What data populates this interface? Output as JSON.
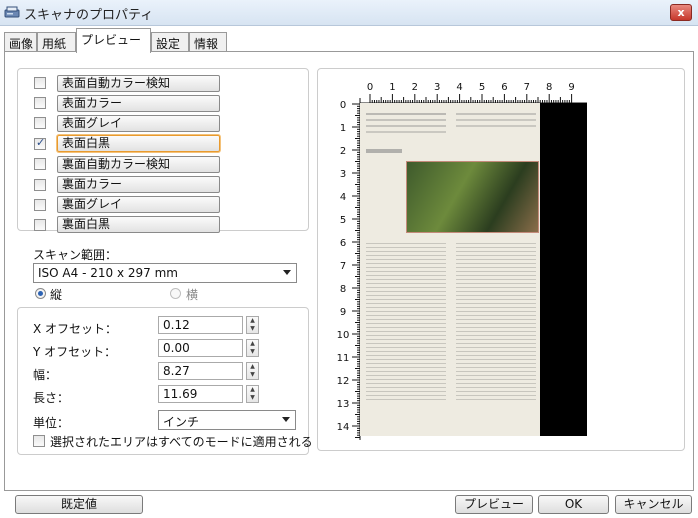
{
  "window": {
    "title": "スキャナのプロパティ",
    "close_label": "x"
  },
  "tabs": [
    {
      "label": "画像",
      "active": false
    },
    {
      "label": "用紙",
      "active": false
    },
    {
      "label": "プレビュー",
      "active": true
    },
    {
      "label": "設定",
      "active": false
    },
    {
      "label": "情報",
      "active": false
    }
  ],
  "modes": [
    {
      "label": "表面自動カラー検知",
      "checked": false,
      "selected": false
    },
    {
      "label": "表面カラー",
      "checked": false,
      "selected": false
    },
    {
      "label": "表面グレイ",
      "checked": false,
      "selected": false
    },
    {
      "label": "表面白黒",
      "checked": true,
      "selected": true
    },
    {
      "label": "裏面自動カラー検知",
      "checked": false,
      "selected": false
    },
    {
      "label": "裏面カラー",
      "checked": false,
      "selected": false
    },
    {
      "label": "裏面グレイ",
      "checked": false,
      "selected": false
    },
    {
      "label": "裏面白黒",
      "checked": false,
      "selected": false
    }
  ],
  "scan_area": {
    "label": "スキャン範囲：",
    "value": "ISO A4 - 210 x 297 mm",
    "portrait_label": "縦",
    "landscape_label": "横",
    "orientation": "portrait"
  },
  "fields": {
    "x_offset": {
      "label": "X オフセット：",
      "value": "0.12"
    },
    "y_offset": {
      "label": "Y オフセット：",
      "value": "0.00"
    },
    "width": {
      "label": "幅：",
      "value": "8.27"
    },
    "length": {
      "label": "長さ：",
      "value": "11.69"
    },
    "unit": {
      "label": "単位：",
      "value": "インチ"
    },
    "apply_all": {
      "label": "選択されたエリアはすべてのモードに適用される",
      "checked": false
    }
  },
  "ruler": {
    "top": [
      "0",
      "1",
      "2",
      "3",
      "4",
      "5",
      "6",
      "7",
      "8",
      "9"
    ],
    "left": [
      "0",
      "1",
      "2",
      "3",
      "4",
      "5",
      "6",
      "7",
      "8",
      "9",
      "10",
      "11",
      "12",
      "13",
      "14"
    ]
  },
  "buttons": {
    "default": "既定値",
    "preview": "プレビュー",
    "ok": "OK",
    "cancel": "キャンセル"
  }
}
